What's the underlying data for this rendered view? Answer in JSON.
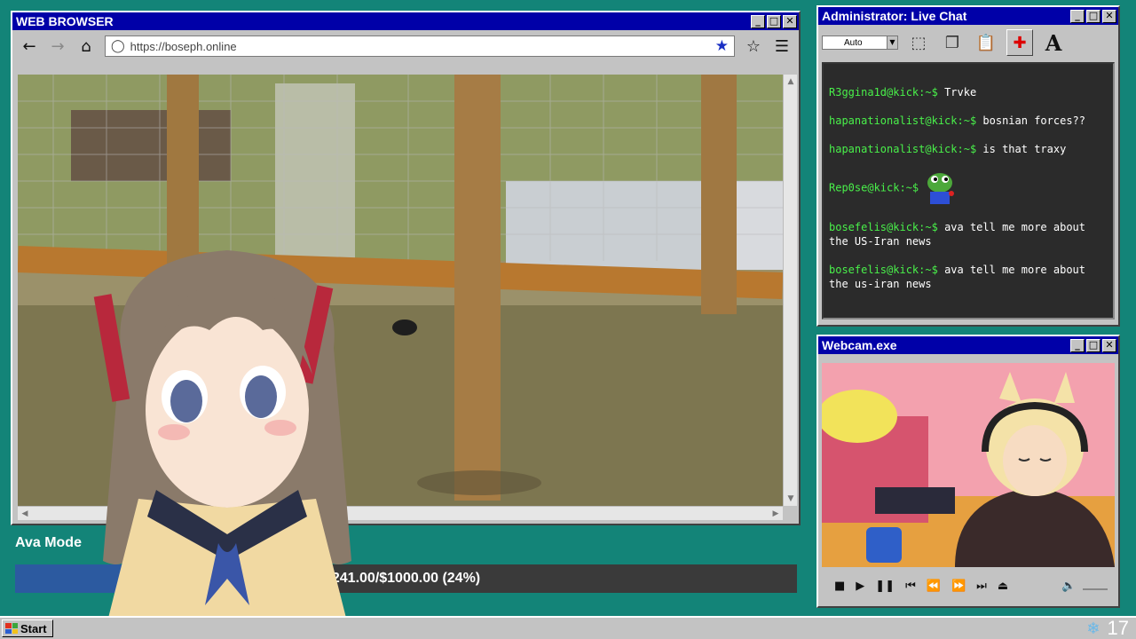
{
  "browser": {
    "title": "WEB BROWSER",
    "url": "https://boseph.online",
    "buttons": {
      "minimize": "_",
      "maximize": "□",
      "close": "✕"
    }
  },
  "chat": {
    "title": "Administrator: Live Chat",
    "zoom_select": "Auto",
    "messages": [
      {
        "user": "R3ggina1d@kick:~$",
        "text": "Trvke"
      },
      {
        "user": "hapanationalist@kick:~$",
        "text": "bosnian forces??"
      },
      {
        "user": "hapanationalist@kick:~$",
        "text": "is that traxy"
      },
      {
        "user": "Rep0se@kick:~$",
        "text": "",
        "emote": "frog-emote"
      },
      {
        "user": "bosefelis@kick:~$",
        "text": "ava tell me more about the US-Iran news"
      },
      {
        "user": "bosefelis@kick:~$",
        "text": "ava tell me more about the us-iran news"
      }
    ]
  },
  "webcam": {
    "title": "Webcam.exe"
  },
  "goal": {
    "label": "Ava Mode",
    "text": "241.00/$1000.00 (24%)",
    "progress": 0.24
  },
  "taskbar": {
    "start": "Start",
    "clock": "17"
  },
  "colors": {
    "desktop": "#138478",
    "titlebar": "#0000a8",
    "chat_user": "#49f04a",
    "goal_fill": "#2c5aa0"
  }
}
